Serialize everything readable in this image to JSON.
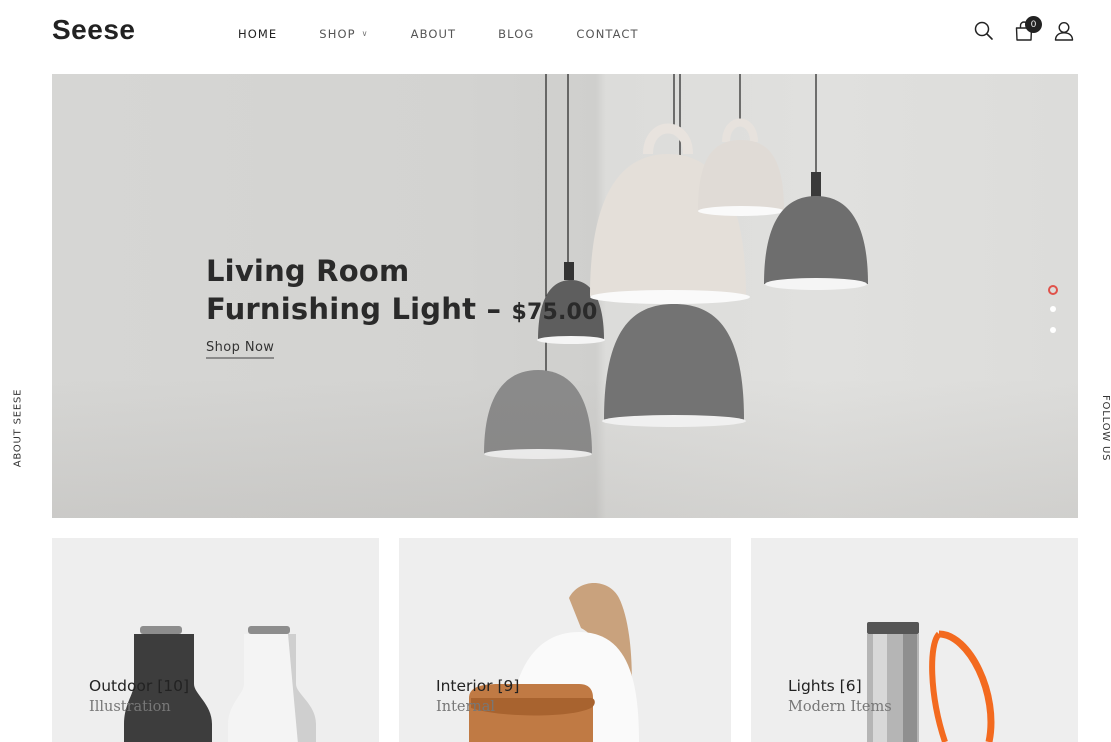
{
  "header": {
    "logo": "Seese",
    "nav": [
      {
        "label": "HOME",
        "active": true
      },
      {
        "label": "SHOP",
        "has_dropdown": true
      },
      {
        "label": "ABOUT"
      },
      {
        "label": "BLOG"
      },
      {
        "label": "CONTACT"
      }
    ],
    "icons": [
      "search-icon",
      "shopping-bag-icon",
      "user-icon"
    ],
    "cart_count": "0"
  },
  "side": {
    "left_label": "ABOUT SEESE",
    "right_label": "FOLLOW US"
  },
  "hero": {
    "title_line1": "Living Room",
    "title_line2": "Furnishing Light",
    "separator": "–",
    "price": "$75.00",
    "cta": "Shop Now",
    "slides_total": 3,
    "active_slide": 1,
    "colors": {
      "accent": "#e0524a"
    }
  },
  "categories": [
    {
      "title": "Outdoor [10]",
      "subtitle": "Illustration"
    },
    {
      "title": "Interior [9]",
      "subtitle": "Internal"
    },
    {
      "title": "Lights [6]",
      "subtitle": "Modern Items"
    }
  ]
}
